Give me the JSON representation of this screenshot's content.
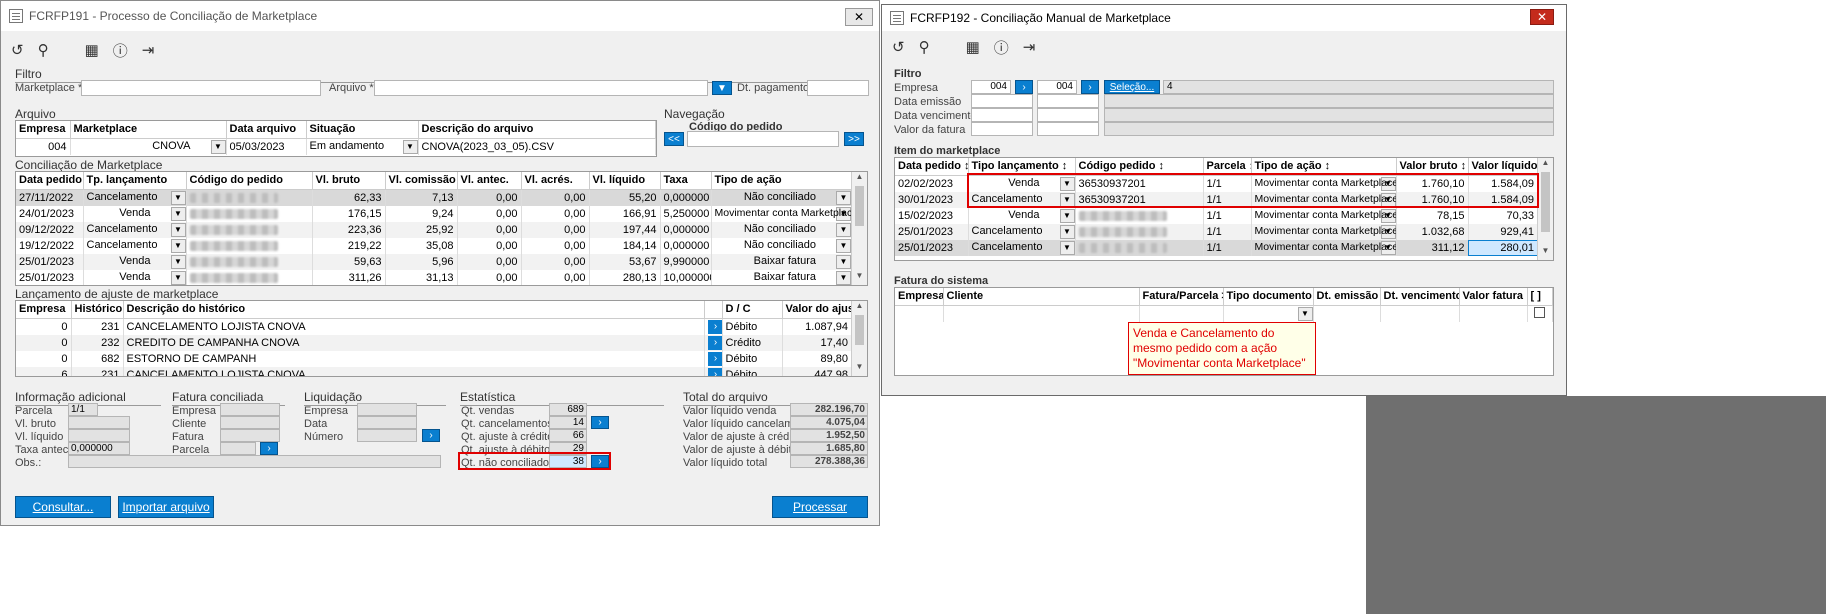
{
  "w1": {
    "title": "FCRFP191 - Processo de Conciliação de Marketplace",
    "filtro": {
      "title": "Filtro",
      "marketplace_label": "Marketplace *",
      "arquivo_label": "Arquivo *",
      "dt_pagamento_label": "Dt. pagamento"
    },
    "arquivo": {
      "title": "Arquivo",
      "headers": [
        "Empresa",
        "Marketplace",
        "Data arquivo",
        "Situação",
        "Descrição do arquivo"
      ],
      "empresa": "004",
      "marketplace": "CNOVA",
      "data": "05/03/2023",
      "situacao": "Em andamento",
      "descricao": "CNOVA(2023_03_05).CSV"
    },
    "navegacao": {
      "title": "Navegação",
      "codigo_label": "Código do pedido",
      "prev": "<<",
      "next": ">>"
    },
    "conc": {
      "title": "Conciliação de Marketplace",
      "headers": [
        "Data pedido",
        "Tp. lançamento",
        "Código do pedido",
        "Vl. bruto",
        "Vl. comissão",
        "Vl. antec.",
        "Vl. acrés.",
        "Vl. líquido",
        "Taxa",
        "Tipo de ação"
      ],
      "rows": [
        [
          "27/11/2022",
          "Cancelamento",
          "",
          "62,33",
          "7,13",
          "0,00",
          "0,00",
          "55,20",
          "0,000000",
          "Não conciliado"
        ],
        [
          "24/01/2023",
          "Venda",
          "",
          "176,15",
          "9,24",
          "0,00",
          "0,00",
          "166,91",
          "5,250000",
          "Movimentar conta Marketplace"
        ],
        [
          "09/12/2022",
          "Cancelamento",
          "",
          "223,36",
          "25,92",
          "0,00",
          "0,00",
          "197,44",
          "0,000000",
          "Não conciliado"
        ],
        [
          "19/12/2022",
          "Cancelamento",
          "",
          "219,22",
          "35,08",
          "0,00",
          "0,00",
          "184,14",
          "0,000000",
          "Não conciliado"
        ],
        [
          "25/01/2023",
          "Venda",
          "",
          "59,63",
          "5,96",
          "0,00",
          "0,00",
          "53,67",
          "9,990000",
          "Baixar fatura"
        ],
        [
          "25/01/2023",
          "Venda",
          "",
          "311,26",
          "31,13",
          "0,00",
          "0,00",
          "280,13",
          "10,000000",
          "Baixar fatura"
        ]
      ]
    },
    "ajuste": {
      "title": "Lançamento de ajuste de marketplace",
      "headers": [
        "Empresa",
        "Histórico",
        "Descrição do histórico",
        "",
        "D / C",
        "Valor do ajuste"
      ],
      "rows": [
        [
          "0",
          "231",
          "CANCELAMENTO LOJISTA CNOVA",
          "Débito",
          "1.087,94"
        ],
        [
          "0",
          "232",
          "CREDITO DE CAMPANHA CNOVA",
          "Crédito",
          "17,40"
        ],
        [
          "0",
          "682",
          "ESTORNO DE CAMPANH",
          "Débito",
          "89,80"
        ],
        [
          "6",
          "231",
          "CANCELAMENTO LOJISTA CNOVA",
          "Débito",
          "447,98"
        ]
      ]
    },
    "info": {
      "title": "Informação adicional",
      "parcela_label": "Parcela",
      "parcela": "1/1",
      "vl_bruto_label": "Vl. bruto",
      "vl_liquido_label": "Vl. líquido",
      "taxa_label": "Taxa antec.",
      "taxa": "0,000000",
      "obs_label": "Obs.:"
    },
    "fatura": {
      "title": "Fatura conciliada",
      "empresa_label": "Empresa",
      "cliente_label": "Cliente",
      "fatura_label": "Fatura",
      "parcela_label": "Parcela"
    },
    "liq": {
      "title": "Liquidação",
      "empresa_label": "Empresa",
      "data_label": "Data",
      "numero_label": "Número"
    },
    "estat": {
      "title": "Estatística",
      "items": [
        [
          "Qt. vendas",
          "689"
        ],
        [
          "Qt. cancelamentos",
          "14"
        ],
        [
          "Qt. ajuste à crédito",
          "66"
        ],
        [
          "Qt. ajuste à débito",
          "29"
        ],
        [
          "Qt. não conciliado",
          "38"
        ]
      ]
    },
    "total": {
      "title": "Total do arquivo",
      "items": [
        [
          "Valor líquido venda",
          "282.196,70"
        ],
        [
          "Valor líquido cancelamento",
          "4.075,04"
        ],
        [
          "Valor de ajuste à crédito",
          "1.952,50"
        ],
        [
          "Valor de ajuste à débito",
          "1.685,80"
        ],
        [
          "Valor líquido total",
          "278.388,36"
        ]
      ]
    },
    "buttons": {
      "consultar": "Consultar...",
      "importar": "Importar arquivo",
      "processar": "Processar"
    }
  },
  "w2": {
    "title": "FCRFP192 - Conciliação Manual de Marketplace",
    "filtro": {
      "title": "Filtro",
      "empresa_label": "Empresa",
      "empresa1": "004",
      "empresa2": "004",
      "selecao": "Seleção...",
      "count": "4",
      "dt_emissao_label": "Data emissão",
      "dt_venc_label": "Data vencimento",
      "valor_label": "Valor da fatura"
    },
    "item": {
      "title": "Item do marketplace",
      "headers": [
        "Data pedido",
        "Tipo lançamento",
        "Código pedido",
        "Parcela",
        "Tipo de ação",
        "Valor bruto",
        "Valor líquido"
      ],
      "rows": [
        [
          "02/02/2023",
          "Venda",
          "36530937201",
          "1/1",
          "Movimentar conta Marketplace",
          "1.760,10",
          "1.584,09"
        ],
        [
          "30/01/2023",
          "Cancelamento",
          "36530937201",
          "1/1",
          "Movimentar conta Marketplace",
          "1.760,10",
          "1.584,09"
        ],
        [
          "15/02/2023",
          "Venda",
          "",
          "1/1",
          "Movimentar conta Marketplace",
          "78,15",
          "70,33"
        ],
        [
          "25/01/2023",
          "Cancelamento",
          "",
          "1/1",
          "Movimentar conta Marketplace",
          "1.032,68",
          "929,41"
        ],
        [
          "25/01/2023",
          "Cancelamento",
          "",
          "1/1",
          "Movimentar conta Marketplace",
          "311,12",
          "280,01"
        ]
      ]
    },
    "fatura": {
      "title": "Fatura do sistema",
      "headers": [
        "Empresa",
        "Cliente",
        "Fatura/Parcela >>",
        "Tipo documento",
        "Dt. emissão",
        "Dt. vencimento",
        "Valor fatura",
        "[ ]"
      ]
    },
    "note": "Venda e Cancelamento do mesmo pedido com a ação \"Movimentar conta Marketplace\""
  }
}
